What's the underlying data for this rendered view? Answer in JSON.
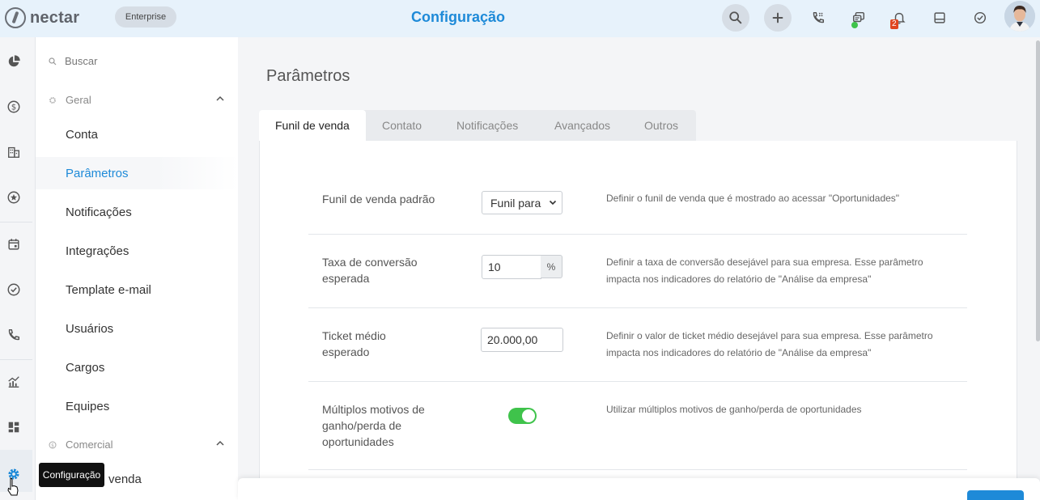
{
  "header": {
    "logo": "nectar",
    "plan": "Enterprise",
    "title": "Configuração",
    "notifications_count": "2",
    "icons": [
      "search-icon",
      "plus-icon",
      "phone-keypad-icon",
      "chat-icon",
      "bell-icon",
      "inbox-icon",
      "check-circle-icon",
      "user-avatar"
    ]
  },
  "rail": {
    "icons": [
      "pie-chart-icon",
      "dollar-icon",
      "building-icon",
      "star-icon",
      "calendar-icon",
      "check-icon",
      "phone-icon",
      "chart-icon",
      "dashboard-icon",
      "gear-icon"
    ],
    "tooltip": "Configuração"
  },
  "settings_nav": {
    "search_label": "Buscar",
    "groups": [
      {
        "label": "Geral",
        "items": [
          "Conta",
          "Parâmetros",
          "Notificações",
          "Integrações",
          "Template e-mail",
          "Usuários",
          "Cargos",
          "Equipes"
        ]
      },
      {
        "label": "Comercial",
        "items": [
          "Funil de venda"
        ]
      }
    ],
    "active_item": "Parâmetros",
    "partial_item_visible": "venda"
  },
  "main": {
    "title": "Parâmetros",
    "tabs": [
      "Funil de venda",
      "Contato",
      "Notificações",
      "Avançados",
      "Outros"
    ],
    "active_tab": "Funil de venda",
    "fields": [
      {
        "label": "Funil de venda padrão",
        "value": "Funil para",
        "help": "Definir o funil de venda que é mostrado ao acessar \"Oportunidades\""
      },
      {
        "label_line1": "Taxa de conversão",
        "label_line2": "esperada",
        "value": "10",
        "suffix": "%",
        "help_line1": "Definir a taxa de conversão desejável para sua empresa. Esse parâmetro",
        "help_line2": "impacta nos indicadores do relatório de \"Análise da empresa\""
      },
      {
        "label_line1": "Ticket médio",
        "label_line2": "esperado",
        "value": "20.000,00",
        "help_line1": "Definir o valor de ticket médio desejável para sua empresa. Esse parâmetro",
        "help_line2": "impacta nos indicadores do relatório de \"Análise da empresa\""
      },
      {
        "label_line1": "Múltiplos motivos de",
        "label_line2": "ganho/perda de",
        "label_line3": "oportunidades",
        "enabled": true,
        "help": "Utilizar múltiplos motivos de ganho/perda de oportunidades"
      }
    ]
  },
  "colors": {
    "accent": "#1e8ad8",
    "toggle_on": "#3fc34b",
    "badge": "#e0461f"
  }
}
